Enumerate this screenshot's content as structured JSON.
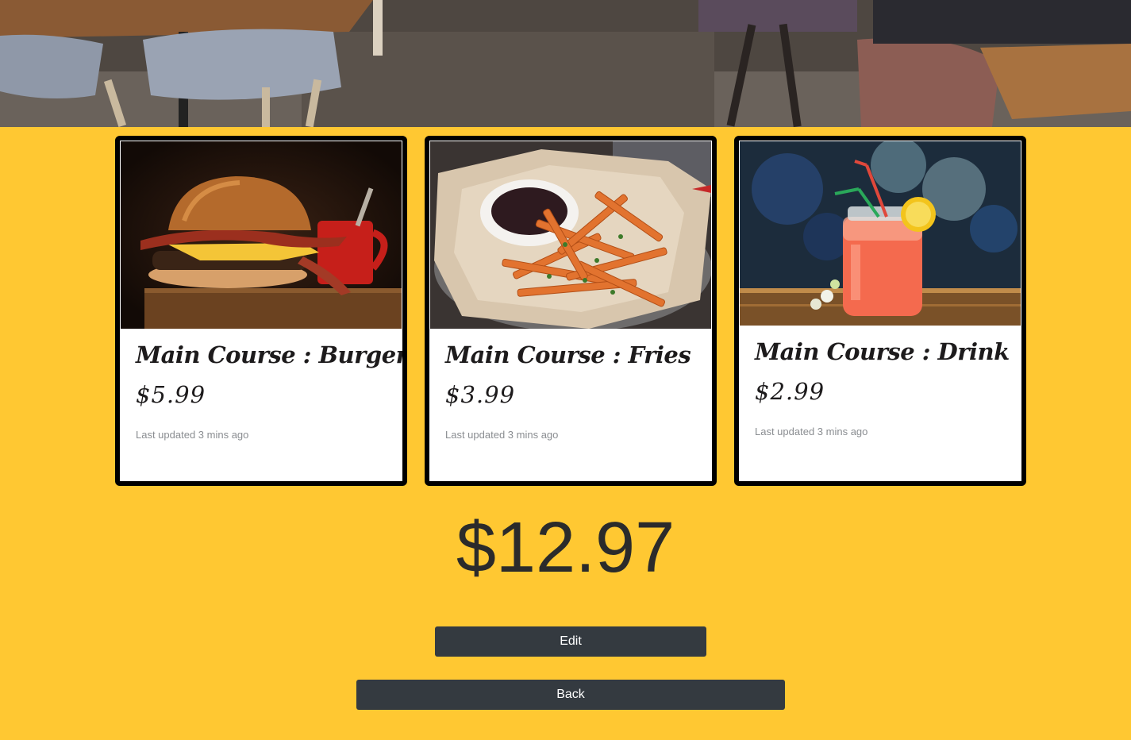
{
  "cards": [
    {
      "title": "Main Course : Burger",
      "price": "$5.99",
      "updated": "Last updated 3 mins ago",
      "image": "burger-photo"
    },
    {
      "title": "Main Course : Fries",
      "price": "$3.99",
      "updated": "Last updated 3 mins ago",
      "image": "fries-photo"
    },
    {
      "title": "Main Course : Drink",
      "price": "$2.99",
      "updated": "Last updated 3 mins ago",
      "image": "drink-photo"
    }
  ],
  "total": "$12.97",
  "buttons": {
    "edit_label": "Edit",
    "back_label": "Back"
  },
  "colors": {
    "page_background": "#ffc832",
    "button_background": "#343a40",
    "card_border": "#000000"
  }
}
